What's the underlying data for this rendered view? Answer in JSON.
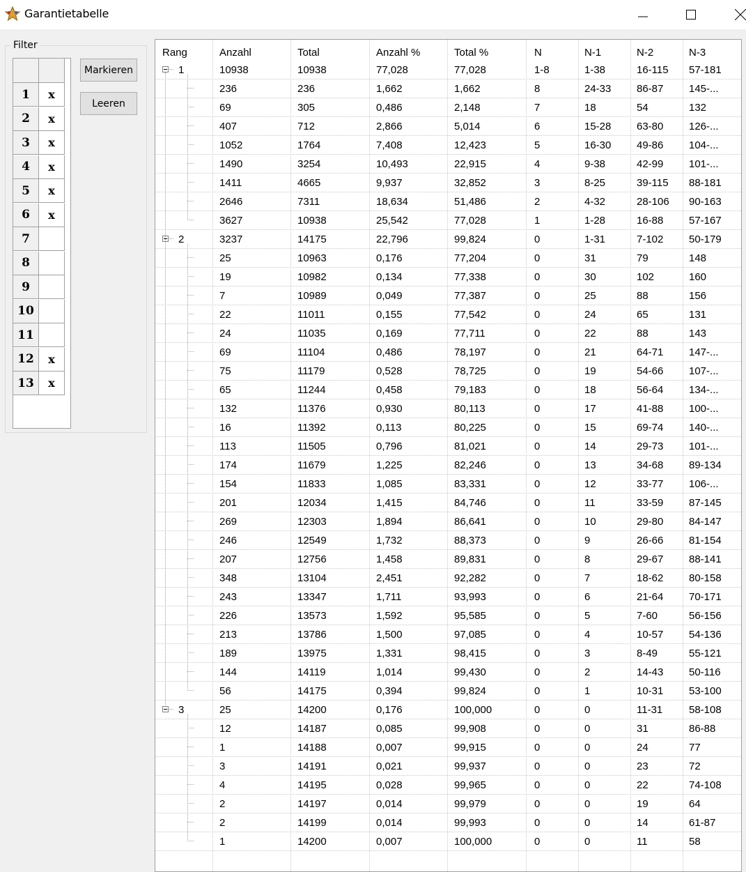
{
  "window": {
    "title": "Garantietabelle",
    "icon": "star-app-icon"
  },
  "filter": {
    "legend": "Filter",
    "rows": [
      {
        "num": "1",
        "val": "x"
      },
      {
        "num": "2",
        "val": "x"
      },
      {
        "num": "3",
        "val": "x"
      },
      {
        "num": "4",
        "val": "x"
      },
      {
        "num": "5",
        "val": "x"
      },
      {
        "num": "6",
        "val": "x"
      },
      {
        "num": "7",
        "val": ""
      },
      {
        "num": "8",
        "val": ""
      },
      {
        "num": "9",
        "val": ""
      },
      {
        "num": "10",
        "val": ""
      },
      {
        "num": "11",
        "val": ""
      },
      {
        "num": "12",
        "val": "x"
      },
      {
        "num": "13",
        "val": "x"
      }
    ],
    "buttons": {
      "mark": "Markieren",
      "clear": "Leeren"
    }
  },
  "table": {
    "columns": [
      "Rang",
      "Anzahl",
      "Total",
      "Anzahl %",
      "Total %",
      "N",
      "N-1",
      "N-2",
      "N-3"
    ],
    "groups": [
      {
        "rang": "1",
        "summary": [
          "10938",
          "10938",
          "77,028",
          "77,028",
          "1-8",
          "1-38",
          "16-115",
          "57-181"
        ],
        "children": [
          [
            "236",
            "236",
            "1,662",
            "1,662",
            "8",
            "24-33",
            "86-87",
            "145-..."
          ],
          [
            "69",
            "305",
            "0,486",
            "2,148",
            "7",
            "18",
            "54",
            "132"
          ],
          [
            "407",
            "712",
            "2,866",
            "5,014",
            "6",
            "15-28",
            "63-80",
            "126-..."
          ],
          [
            "1052",
            "1764",
            "7,408",
            "12,423",
            "5",
            "16-30",
            "49-86",
            "104-..."
          ],
          [
            "1490",
            "3254",
            "10,493",
            "22,915",
            "4",
            "9-38",
            "42-99",
            "101-..."
          ],
          [
            "1411",
            "4665",
            "9,937",
            "32,852",
            "3",
            "8-25",
            "39-115",
            "88-181"
          ],
          [
            "2646",
            "7311",
            "18,634",
            "51,486",
            "2",
            "4-32",
            "28-106",
            "90-163"
          ],
          [
            "3627",
            "10938",
            "25,542",
            "77,028",
            "1",
            "1-28",
            "16-88",
            "57-167"
          ]
        ]
      },
      {
        "rang": "2",
        "summary": [
          "3237",
          "14175",
          "22,796",
          "99,824",
          "0",
          "1-31",
          "7-102",
          "50-179"
        ],
        "children": [
          [
            "25",
            "10963",
            "0,176",
            "77,204",
            "0",
            "31",
            "79",
            "148"
          ],
          [
            "19",
            "10982",
            "0,134",
            "77,338",
            "0",
            "30",
            "102",
            "160"
          ],
          [
            "7",
            "10989",
            "0,049",
            "77,387",
            "0",
            "25",
            "88",
            "156"
          ],
          [
            "22",
            "11011",
            "0,155",
            "77,542",
            "0",
            "24",
            "65",
            "131"
          ],
          [
            "24",
            "11035",
            "0,169",
            "77,711",
            "0",
            "22",
            "88",
            "143"
          ],
          [
            "69",
            "11104",
            "0,486",
            "78,197",
            "0",
            "21",
            "64-71",
            "147-..."
          ],
          [
            "75",
            "11179",
            "0,528",
            "78,725",
            "0",
            "19",
            "54-66",
            "107-..."
          ],
          [
            "65",
            "11244",
            "0,458",
            "79,183",
            "0",
            "18",
            "56-64",
            "134-..."
          ],
          [
            "132",
            "11376",
            "0,930",
            "80,113",
            "0",
            "17",
            "41-88",
            "100-..."
          ],
          [
            "16",
            "11392",
            "0,113",
            "80,225",
            "0",
            "15",
            "69-74",
            "140-..."
          ],
          [
            "113",
            "11505",
            "0,796",
            "81,021",
            "0",
            "14",
            "29-73",
            "101-..."
          ],
          [
            "174",
            "11679",
            "1,225",
            "82,246",
            "0",
            "13",
            "34-68",
            "89-134"
          ],
          [
            "154",
            "11833",
            "1,085",
            "83,331",
            "0",
            "12",
            "33-77",
            "106-..."
          ],
          [
            "201",
            "12034",
            "1,415",
            "84,746",
            "0",
            "11",
            "33-59",
            "87-145"
          ],
          [
            "269",
            "12303",
            "1,894",
            "86,641",
            "0",
            "10",
            "29-80",
            "84-147"
          ],
          [
            "246",
            "12549",
            "1,732",
            "88,373",
            "0",
            "9",
            "26-66",
            "81-154"
          ],
          [
            "207",
            "12756",
            "1,458",
            "89,831",
            "0",
            "8",
            "29-67",
            "88-141"
          ],
          [
            "348",
            "13104",
            "2,451",
            "92,282",
            "0",
            "7",
            "18-62",
            "80-158"
          ],
          [
            "243",
            "13347",
            "1,711",
            "93,993",
            "0",
            "6",
            "21-64",
            "70-171"
          ],
          [
            "226",
            "13573",
            "1,592",
            "95,585",
            "0",
            "5",
            "7-60",
            "56-156"
          ],
          [
            "213",
            "13786",
            "1,500",
            "97,085",
            "0",
            "4",
            "10-57",
            "54-136"
          ],
          [
            "189",
            "13975",
            "1,331",
            "98,415",
            "0",
            "3",
            "8-49",
            "55-121"
          ],
          [
            "144",
            "14119",
            "1,014",
            "99,430",
            "0",
            "2",
            "14-43",
            "50-116"
          ],
          [
            "56",
            "14175",
            "0,394",
            "99,824",
            "0",
            "1",
            "10-31",
            "53-100"
          ]
        ]
      },
      {
        "rang": "3",
        "summary": [
          "25",
          "14200",
          "0,176",
          "100,000",
          "0",
          "0",
          "11-31",
          "58-108"
        ],
        "children": [
          [
            "12",
            "14187",
            "0,085",
            "99,908",
            "0",
            "0",
            "31",
            "86-88"
          ],
          [
            "1",
            "14188",
            "0,007",
            "99,915",
            "0",
            "0",
            "24",
            "77"
          ],
          [
            "3",
            "14191",
            "0,021",
            "99,937",
            "0",
            "0",
            "23",
            "72"
          ],
          [
            "4",
            "14195",
            "0,028",
            "99,965",
            "0",
            "0",
            "22",
            "74-108"
          ],
          [
            "2",
            "14197",
            "0,014",
            "99,979",
            "0",
            "0",
            "19",
            "64"
          ],
          [
            "2",
            "14199",
            "0,014",
            "99,993",
            "0",
            "0",
            "14",
            "61-87"
          ],
          [
            "1",
            "14200",
            "0,007",
            "100,000",
            "0",
            "0",
            "11",
            "58"
          ]
        ]
      }
    ]
  }
}
